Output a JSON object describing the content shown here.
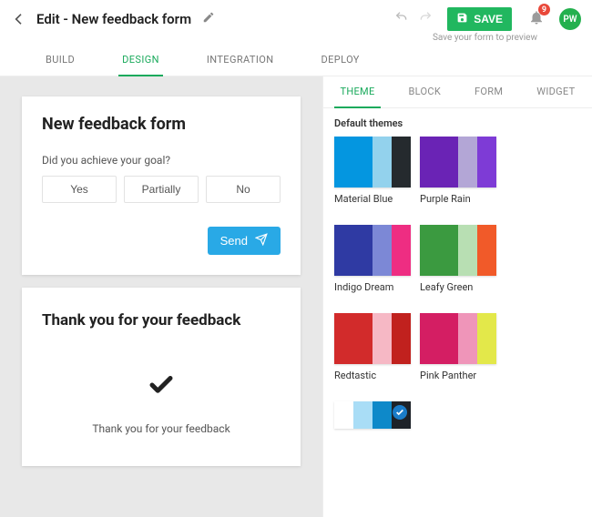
{
  "header": {
    "title": "Edit - New feedback form",
    "save_label": "SAVE",
    "save_hint": "Save your form to preview",
    "notif_count": "9",
    "avatar_initials": "PW"
  },
  "main_tabs": {
    "build": "BUILD",
    "design": "DESIGN",
    "integration": "INTEGRATION",
    "deploy": "DEPLOY"
  },
  "form_card": {
    "title": "New feedback form",
    "question": "Did you achieve your goal?",
    "options": {
      "yes": "Yes",
      "partially": "Partially",
      "no": "No"
    },
    "send_label": "Send"
  },
  "thanks_card": {
    "title": "Thank you for your feedback",
    "body": "Thank you for your feedback"
  },
  "panel_tabs": {
    "theme": "THEME",
    "block": "BLOCK",
    "form": "FORM",
    "widget": "WIDGET"
  },
  "themes": {
    "section_label": "Default themes",
    "items": [
      {
        "name": "Material Blue",
        "colors": [
          "#0496e0",
          "#93d2ed",
          "#252a2e"
        ]
      },
      {
        "name": "Purple Rain",
        "colors": [
          "#6a23b5",
          "#b3a6d6",
          "#7e3bd6"
        ]
      },
      {
        "name": "Indigo Dream",
        "colors": [
          "#2f3aa3",
          "#7c88d6",
          "#ee2d82"
        ]
      },
      {
        "name": "Leafy Green",
        "colors": [
          "#3b9a40",
          "#b8dfb3",
          "#f15a29"
        ]
      },
      {
        "name": "Redtastic",
        "colors": [
          "#d22b2b",
          "#f6b8c5",
          "#c1211e"
        ]
      },
      {
        "name": "Pink Panther",
        "colors": [
          "#d41e63",
          "#ef95b9",
          "#e3e84a"
        ]
      }
    ],
    "selected": {
      "colors": [
        "#ffffff",
        "#a9ddf6",
        "#0e89c9",
        "#1d2228"
      ]
    }
  }
}
